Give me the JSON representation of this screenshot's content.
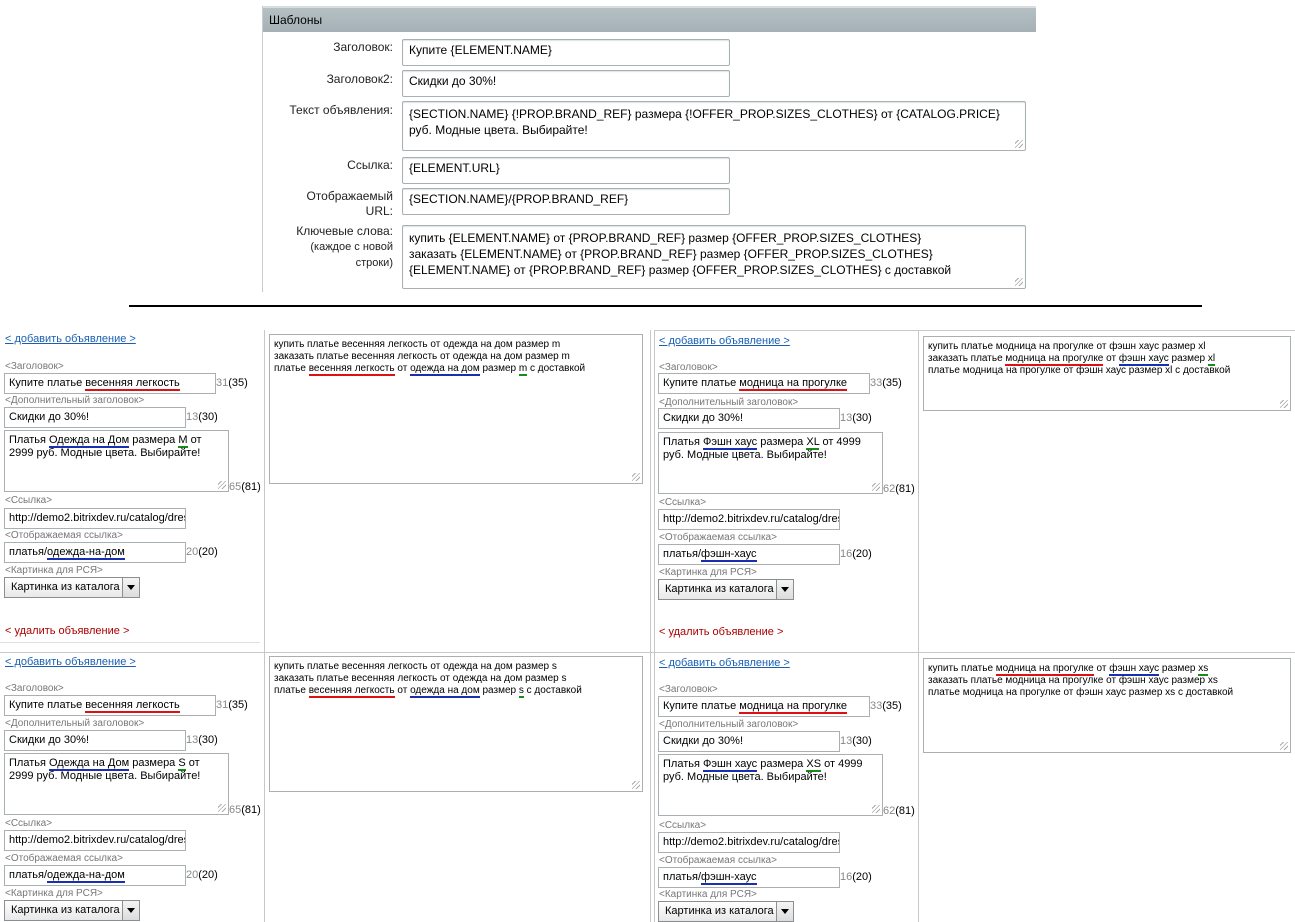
{
  "templates": {
    "header": "Шаблоны",
    "title_label": "Заголовок:",
    "title_value": "Купите {ELEMENT.NAME}",
    "title2_label": "Заголовок2:",
    "title2_value": "Скидки до 30%!",
    "text_label": "Текст объявления:",
    "text_value": "{SECTION.NAME} {!PROP.BRAND_REF} размера {!OFFER_PROP.SIZES_CLOTHES} от {CATALOG.PRICE} руб. Модные цвета. Выбирайте!",
    "link_label": "Ссылка:",
    "link_value": "{ELEMENT.URL}",
    "display_url_label_1": "Отображаемый",
    "display_url_label_2": "URL:",
    "display_url_value": "{SECTION.NAME}/{PROP.BRAND_REF}",
    "keywords_label": "Ключевые слова:",
    "keywords_hint_1": "(каждое с новой",
    "keywords_hint_2": "строки)",
    "keywords_lines": [
      "купить {ELEMENT.NAME} от {PROP.BRAND_REF} размер {OFFER_PROP.SIZES_CLOTHES}",
      "заказать {ELEMENT.NAME} от {PROP.BRAND_REF} размер {OFFER_PROP.SIZES_CLOTHES}",
      "{ELEMENT.NAME} от {PROP.BRAND_REF} размер {OFFER_PROP.SIZES_CLOTHES} с доставкой"
    ]
  },
  "common": {
    "add_ad": "< добавить объявление >",
    "delete_ad": "< удалить объявление >",
    "title_label": "<Заголовок>",
    "subtitle_label": "<Дополнительный заголовок>",
    "link_label": "<Ссылка>",
    "display_link_label": "<Отображаемая ссылка>",
    "image_label": "<Картинка для РСЯ>",
    "image_option": "Картинка из каталога",
    "subtitle_value": "Скидки до 30%!",
    "subtitle_count": "13",
    "subtitle_max": "(30)",
    "url_value": "http://demo2.bitrixdev.ru/catalog/dress"
  },
  "ads": [
    {
      "title_pre": "Купите платье ",
      "title_hl": "весенняя легкость",
      "title_count": "31",
      "title_max": "(35)",
      "text_p1": "Платья ",
      "text_brand": "Одежда на Дом",
      "text_p2": " размера ",
      "text_size": "M",
      "text_p3": " от 2999 руб. Модные цвета. Выбирайте!",
      "text_count": "65",
      "text_max": "(81)",
      "display_pre": "платья/",
      "display_brand": "одежда-на-дом",
      "display_count": "20",
      "display_max": "(20)",
      "kw1": "купить платье весенняя легкость от одежда на дом размер m",
      "kw2": "заказать платье весенняя легкость от одежда на дом размер m",
      "kw3_pre": "платье ",
      "kw3_name": "весенняя легкость",
      "kw3_mid": " от ",
      "kw3_brand": "одежда на дом",
      "kw3_mid2": " размер ",
      "kw3_size": "m",
      "kw3_post": " с доставкой"
    },
    {
      "title_pre": "Купите платье ",
      "title_hl": "модница на прогулке",
      "title_count": "33",
      "title_max": "(35)",
      "text_p1": "Платья ",
      "text_brand": "Фэшн хаус",
      "text_p2": " размера ",
      "text_size": "XL",
      "text_p3": " от 4999 руб. Модные цвета. Выбирайте!",
      "text_count": "62",
      "text_max": "(81)",
      "display_pre": "платья/",
      "display_brand": "фэшн-хаус",
      "display_count": "16",
      "display_max": "(20)",
      "kw1": "купить платье модница на прогулке от фэшн хаус размер xl",
      "kw2_pre": "заказать платье ",
      "kw2_name": "модница на прогулке",
      "kw2_mid": " от ",
      "kw2_brand": "фэшн хаус",
      "kw2_mid2": " размер ",
      "kw2_size": "xl",
      "kw3": "платье модница на прогулке от фэшн хаус размер xl с доставкой"
    },
    {
      "title_pre": "Купите платье ",
      "title_hl": "весенняя легкость",
      "title_count": "31",
      "title_max": "(35)",
      "text_p1": "Платья ",
      "text_brand": "Одежда на Дом",
      "text_p2": " размера ",
      "text_size": "S",
      "text_p3": " от 2999 руб. Модные цвета. Выбирайте!",
      "text_count": "65",
      "text_max": "(81)",
      "display_pre": "платья/",
      "display_brand": "одежда-на-дом",
      "display_count": "20",
      "display_max": "(20)",
      "kw1": "купить платье весенняя легкость от одежда на дом размер s",
      "kw2": "заказать платье весенняя легкость от одежда на дом размер s",
      "kw3_pre": "платье ",
      "kw3_name": "весенняя легкость",
      "kw3_mid": " от ",
      "kw3_brand": "одежда на дом",
      "kw3_mid2": " размер ",
      "kw3_size": "s",
      "kw3_post": " с доставкой"
    },
    {
      "title_pre": "Купите платье ",
      "title_hl": "модница на прогулке",
      "title_count": "33",
      "title_max": "(35)",
      "text_p1": "Платья ",
      "text_brand": "Фэшн хаус",
      "text_p2": " размера ",
      "text_size": "XS",
      "text_p3": " от 4999 руб. Модные цвета. Выбирайте!",
      "text_count": "62",
      "text_max": "(81)",
      "display_pre": "платья/",
      "display_brand": "фэшн-хаус",
      "display_count": "16",
      "display_max": "(20)",
      "kw1_pre": "купить платье ",
      "kw1_name": "модница на прогулке",
      "kw1_mid": " от ",
      "kw1_brand": "фэшн хаус",
      "kw1_mid2": " размер ",
      "kw1_size": "xs",
      "kw2": "заказать платье модница на прогулке от фэшн хаус размер xs",
      "kw3": "платье модница на прогулке от фэшн хаус размер xs с доставкой"
    }
  ]
}
